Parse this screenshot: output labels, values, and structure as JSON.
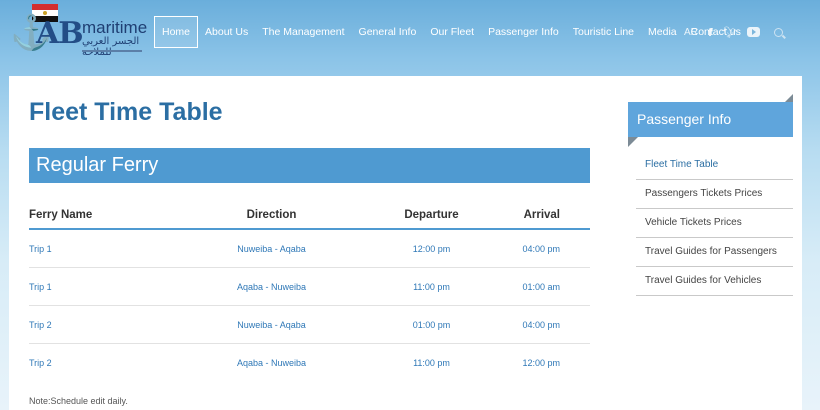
{
  "logo": {
    "brand": "AB",
    "word": "maritime",
    "arabic": "الجسر العربي للملاحة"
  },
  "nav": {
    "items": [
      {
        "label": "Home"
      },
      {
        "label": "About Us"
      },
      {
        "label": "The Management"
      },
      {
        "label": "General Info"
      },
      {
        "label": "Our Fleet"
      },
      {
        "label": "Passenger Info"
      },
      {
        "label": "Touristic Line"
      },
      {
        "label": "Media"
      },
      {
        "label": "Contact us"
      }
    ],
    "lang": "AR",
    "icons": [
      "facebook-icon",
      "twitter-icon",
      "youtube-icon",
      "search-icon"
    ]
  },
  "page": {
    "title": "Fleet Time Table",
    "section": "Regular Ferry",
    "note": "Note:Schedule edit daily."
  },
  "table": {
    "headers": [
      "Ferry Name",
      "Direction",
      "Departure",
      "Arrival"
    ],
    "rows": [
      [
        "Trip 1",
        "Nuweiba - Aqaba",
        "12:00 pm",
        "04:00 pm"
      ],
      [
        "Trip 1",
        "Aqaba - Nuweiba",
        "11:00 pm",
        "01:00 am"
      ],
      [
        "Trip 2",
        "Nuweiba - Aqaba",
        "01:00 pm",
        "04:00 pm"
      ],
      [
        "Trip 2",
        "Aqaba - Nuweiba",
        "11:00 pm",
        "12:00 pm"
      ]
    ]
  },
  "sidebar": {
    "title": "Passenger Info",
    "items": [
      {
        "label": "Fleet Time Table"
      },
      {
        "label": "Passengers Tickets Prices"
      },
      {
        "label": "Vehicle Tickets Prices"
      },
      {
        "label": "Travel Guides for Passengers"
      },
      {
        "label": "Travel Guides for Vehicles"
      }
    ]
  },
  "colors": {
    "accent": "#4f9ad1",
    "title": "#2b6ea3",
    "link": "#2f78b7"
  }
}
